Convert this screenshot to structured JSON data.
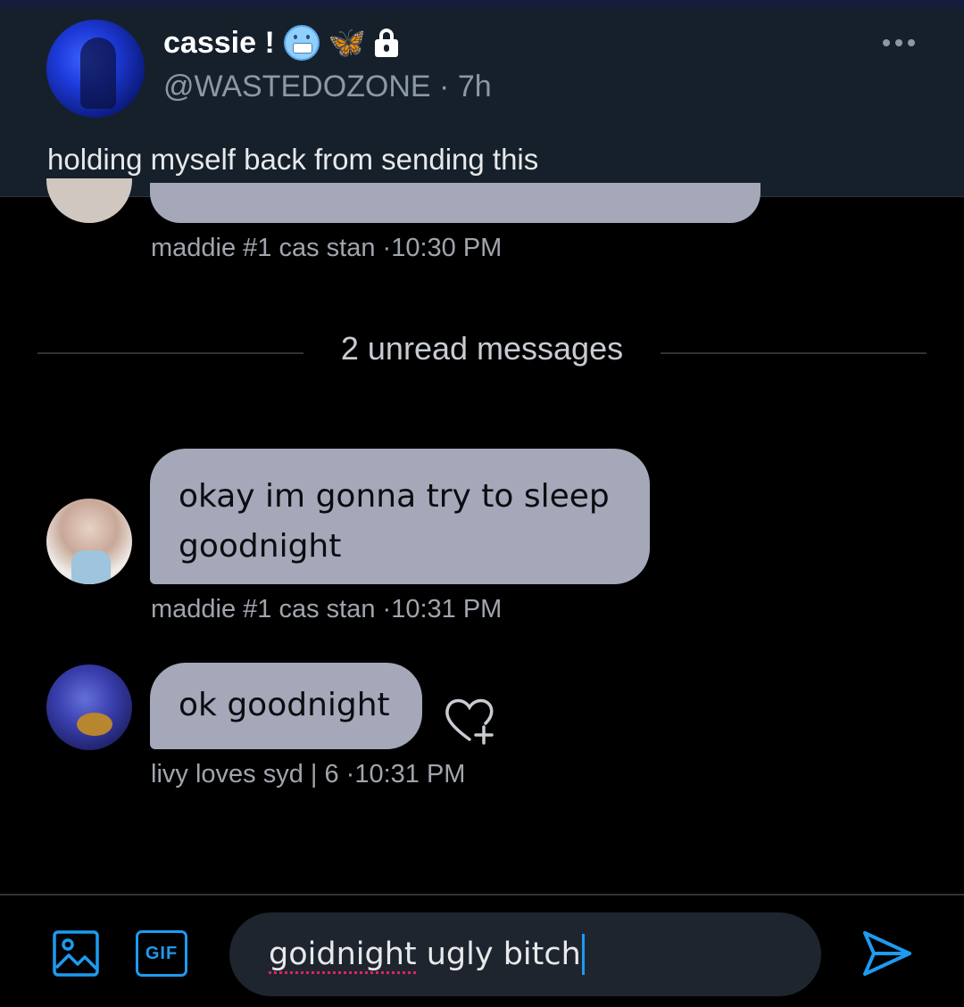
{
  "tweet": {
    "display_name": "cassie !",
    "badges": [
      "cold-face-emoji",
      "butterfly-emoji",
      "lock-icon"
    ],
    "butterfly_glyph": "🦋",
    "handle": "@WASTEDOZONE",
    "time": "· 7h",
    "text": "holding myself back from sending this"
  },
  "dm": {
    "previous_meta": {
      "sender": "maddie #1 cas stan",
      "time": "·10:30 PM"
    },
    "unread_divider": "2 unread messages",
    "messages": [
      {
        "sender": "maddie #1 cas stan",
        "line1": "okay im gonna try to sleep",
        "line2": "goodnight",
        "time": "·10:31 PM"
      },
      {
        "sender": "livy loves syd | 6",
        "text": "ok goodnight",
        "time": "·10:31 PM"
      }
    ],
    "compose": {
      "misspelled_word": "goidnight",
      "rest_text": " ugly bitch",
      "gif_label": "GIF"
    }
  },
  "colors": {
    "accent": "#1d9bf0",
    "bubble": "#a4a8b8",
    "header_bg": "#15202b",
    "background": "#000000",
    "spellcheck": "#e0245e"
  }
}
